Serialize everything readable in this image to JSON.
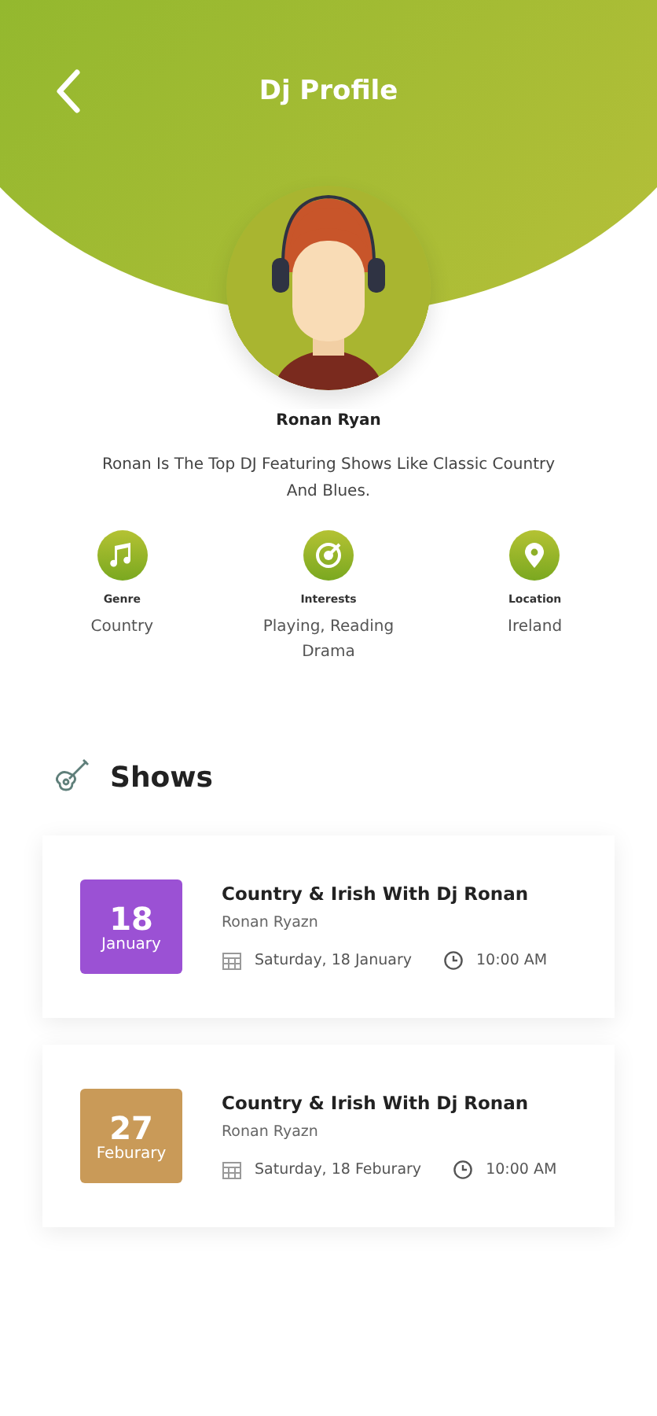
{
  "header": {
    "title": "Dj Profile"
  },
  "profile": {
    "name": "Ronan Ryan",
    "bio": "Ronan Is The Top DJ Featuring Shows Like Classic Country And Blues."
  },
  "info": [
    {
      "kind": "genre",
      "label": "Genre",
      "value": "Country"
    },
    {
      "kind": "interests",
      "label": "Interests",
      "value": "Playing, Reading Drama"
    },
    {
      "kind": "location",
      "label": "Location",
      "value": "Ireland"
    }
  ],
  "shows_section": {
    "title": "Shows"
  },
  "shows": [
    {
      "day": "18",
      "month": "January",
      "color": "#9b51d4",
      "title": "Country & Irish With Dj Ronan",
      "host": "Ronan Ryazn",
      "date": "Saturday, 18 January",
      "time": "10:00 AM"
    },
    {
      "day": "27",
      "month": "Feburary",
      "color": "#c99a58",
      "title": "Country & Irish With Dj Ronan",
      "host": "Ronan Ryazn",
      "date": "Saturday, 18 Feburary",
      "time": "10:00 AM"
    }
  ]
}
